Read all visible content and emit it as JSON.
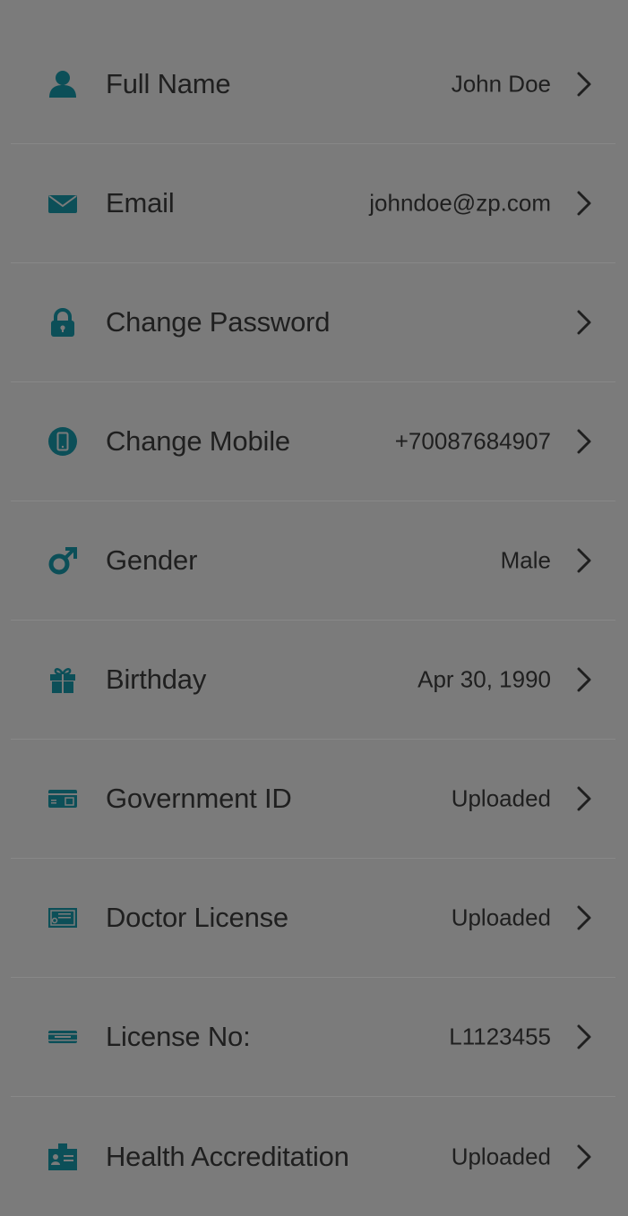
{
  "colors": {
    "background": "#7b7b7b",
    "icon": "#0c4f58",
    "text": "#1f1f1f",
    "divider": "#888888"
  },
  "settings": {
    "items": [
      {
        "label": "Full Name",
        "value": "John Doe",
        "icon": "user-icon"
      },
      {
        "label": "Email",
        "value": "johndoe@zp.com",
        "icon": "envelope-icon"
      },
      {
        "label": "Change Password",
        "value": "",
        "icon": "lock-icon"
      },
      {
        "label": "Change Mobile",
        "value": "+70087684907",
        "icon": "mobile-icon"
      },
      {
        "label": "Gender",
        "value": "Male",
        "icon": "male-icon"
      },
      {
        "label": "Birthday",
        "value": "Apr 30, 1990",
        "icon": "gift-icon"
      },
      {
        "label": "Government ID",
        "value": "Uploaded",
        "icon": "id-card-icon"
      },
      {
        "label": "Doctor License",
        "value": "Uploaded",
        "icon": "certificate-icon"
      },
      {
        "label": "License No:",
        "value": "L1123455",
        "icon": "license-number-icon"
      },
      {
        "label": "Health Accreditation",
        "value": "Uploaded",
        "icon": "badge-icon"
      }
    ]
  }
}
